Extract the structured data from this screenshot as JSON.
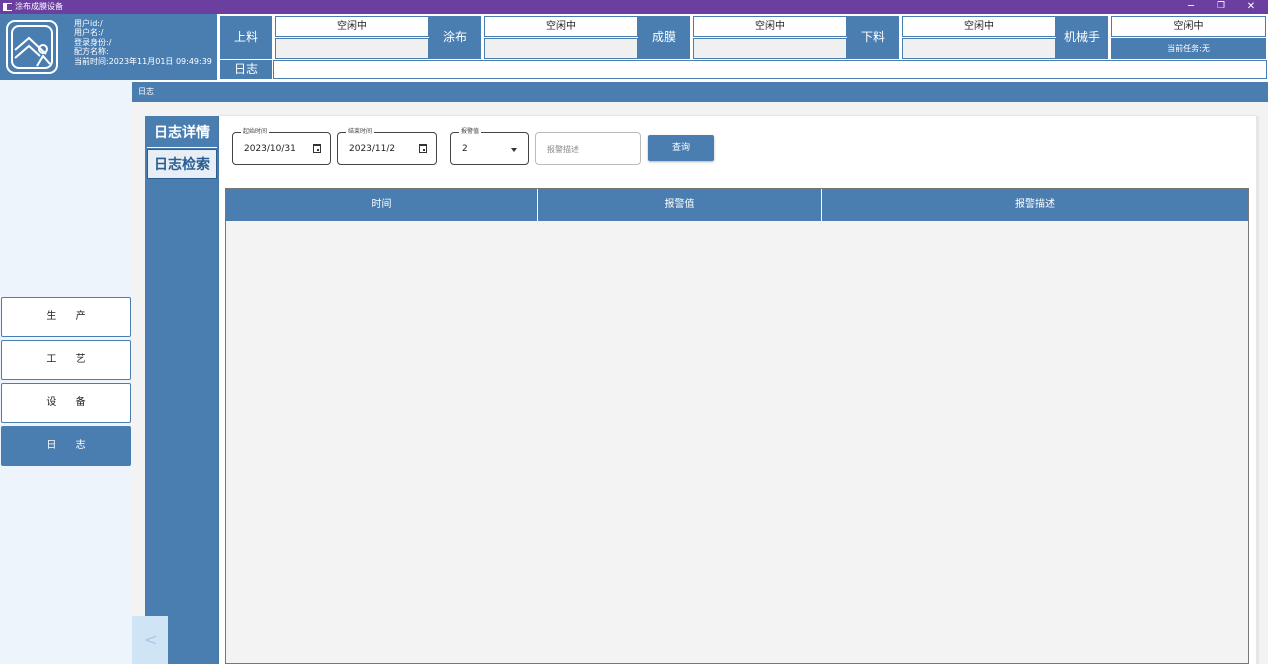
{
  "window": {
    "title": "涂布成膜设备",
    "minimize": "─",
    "restore": "❐",
    "close": "✕"
  },
  "user": {
    "line1": "用户id:/",
    "line2": "用户名:/",
    "line3": "登录身份:/",
    "line4": "配方名称:",
    "line5": "当前时间:2023年11月01日 09:49:39"
  },
  "stages": [
    {
      "label": "上料",
      "status": "空闲中",
      "task": ""
    },
    {
      "label": "涂布",
      "status": "空闲中",
      "task": ""
    },
    {
      "label": "成膜",
      "status": "空闲中",
      "task": ""
    },
    {
      "label": "下料",
      "status": "空闲中",
      "task": ""
    },
    {
      "label": "机械手",
      "status": "空闲中",
      "task": "当前任务:无"
    }
  ],
  "log_label": "日志",
  "nav": {
    "items": [
      "生 产",
      "工 艺",
      "设 备",
      "日 志"
    ],
    "active": "日 志",
    "collapse": "<"
  },
  "breadcrumb": "日志",
  "sub_tabs": [
    "日志详情",
    "日志检索"
  ],
  "filters": {
    "start_label": "起始时间",
    "start_value": "2023/10/31",
    "end_label": "结束时间",
    "end_value": "2023/11/2",
    "alarm_label": "报警值",
    "alarm_value": "2",
    "desc_placeholder": "报警描述",
    "query_button": "查询"
  },
  "table": {
    "columns": [
      "时间",
      "报警值",
      "报警描述"
    ],
    "rows": []
  },
  "colors": {
    "title_bar": "#6b3fa0",
    "accent": "#4a7eb0",
    "nav_bg": "#eef4fb",
    "content_bg": "#f3f3f3"
  }
}
